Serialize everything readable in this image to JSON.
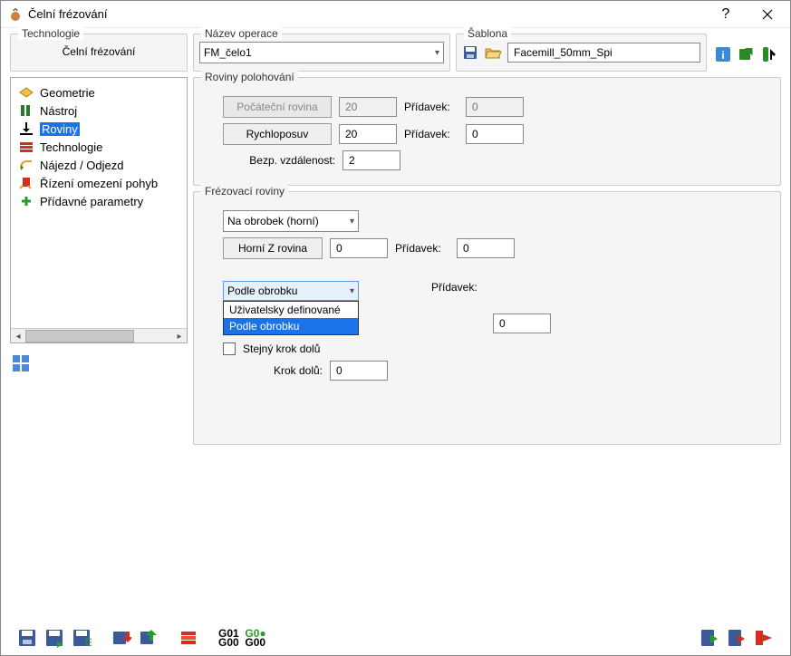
{
  "window": {
    "title": "Čelní frézování"
  },
  "header": {
    "technologie_label": "Technologie",
    "technologie_value": "Čelní frézování",
    "nazev_operace_label": "Název operace",
    "nazev_operace_value": "FM_čelo1",
    "sablona_label": "Šablona",
    "sablona_value": "Facemill_50mm_Spi"
  },
  "tree": [
    {
      "label": "Geometrie",
      "icon": "geometry-icon"
    },
    {
      "label": "Nástroj",
      "icon": "tool-icon"
    },
    {
      "label": "Roviny",
      "icon": "levels-icon",
      "selected": true
    },
    {
      "label": "Technologie",
      "icon": "technology-icon"
    },
    {
      "label": "Nájezd / Odjezd",
      "icon": "link-icon"
    },
    {
      "label": "Řízení omezení pohyb",
      "icon": "motion-icon"
    },
    {
      "label": "Přídavné parametry",
      "icon": "plus-icon"
    }
  ],
  "pos_levels": {
    "title": "Roviny polohování",
    "start_label": "Počáteční rovina",
    "start_value": "20",
    "pridavek_label": "Přídavek:",
    "start_pridavek": "0",
    "clearance_label": "Rychloposuv",
    "clearance_value": "20",
    "clearance_pridavek": "0",
    "safety_label": "Bezp. vzdálenost:",
    "safety_value": "2"
  },
  "mill_levels": {
    "title": "Frézovací roviny",
    "ref_select": "Na obrobek (horní)",
    "upper_btn": "Horní Z rovina",
    "upper_value": "0",
    "upper_pridavek": "0",
    "pridavek_label": "Přídavek:",
    "depth_select": "Podle obrobku",
    "depth_options": [
      "Uživatelsky definované",
      "Podle obrobku"
    ],
    "depth_pridavek": "0",
    "equal_step_label": "Stejný krok dolů",
    "step_down_label": "Krok dolů:",
    "step_down_value": "0"
  },
  "toolbar_codes": {
    "g01": "G01",
    "g00a": "G00",
    "g00b": "G0",
    "g00c": "G00"
  }
}
